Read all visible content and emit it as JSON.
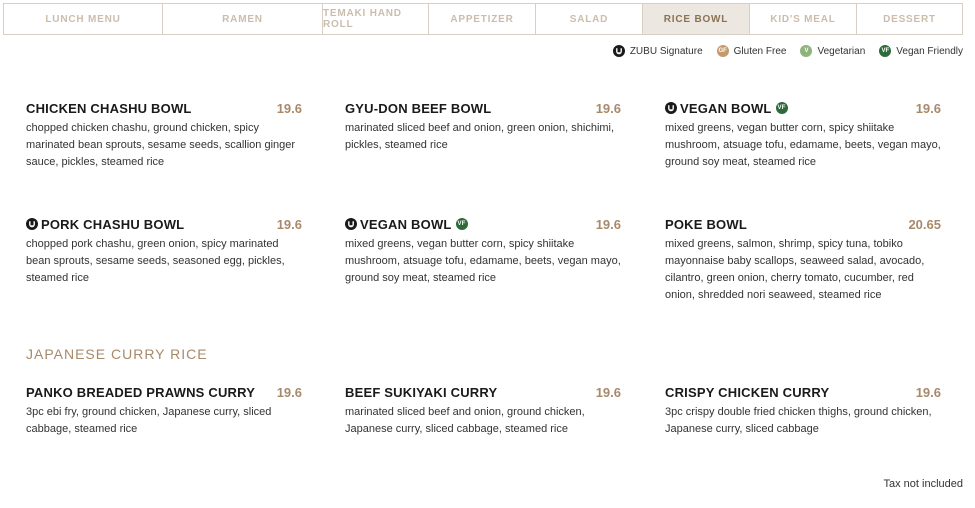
{
  "tabs": [
    {
      "label": "LUNCH MENU",
      "active": false
    },
    {
      "label": "RAMEN",
      "active": false
    },
    {
      "label": "TEMAKI HAND ROLL",
      "active": false
    },
    {
      "label": "APPETIZER",
      "active": false
    },
    {
      "label": "SALAD",
      "active": false
    },
    {
      "label": "RICE BOWL",
      "active": true
    },
    {
      "label": "KID'S MEAL",
      "active": false
    },
    {
      "label": "DESSERT",
      "active": false
    }
  ],
  "legend": {
    "zubu": {
      "abbr": "",
      "label": "ZUBU Signature",
      "color": "#1a1a1a",
      "icon": "zubu-signature-icon"
    },
    "gf": {
      "abbr": "GF",
      "label": "Gluten Free",
      "color": "#c49a6c",
      "icon": "gluten-free-icon"
    },
    "v": {
      "abbr": "V",
      "label": "Vegetarian",
      "color": "#8fb37d",
      "icon": "vegetarian-icon"
    },
    "vf": {
      "abbr": "VF",
      "label": "Vegan Friendly",
      "color": "#2f6b3a",
      "icon": "vegan-friendly-icon"
    }
  },
  "bowls": [
    {
      "name": "CHICKEN CHASHU BOWL",
      "price": "19.6",
      "desc": "chopped chicken chashu, ground chicken, spicy marinated bean sprouts, sesame seeds, scallion ginger sauce, pickles, steamed rice"
    },
    {
      "name": "GYU-DON BEEF BOWL",
      "price": "19.6",
      "desc": "marinated sliced beef and onion, green onion, shichimi, pickles, steamed rice"
    },
    {
      "name": "VEGAN BOWL",
      "price": "19.6",
      "desc": "mixed greens, vegan butter corn, spicy shiitake mushroom, atsuage tofu, edamame, beets, vegan mayo, ground soy meat, steamed rice"
    },
    {
      "name": "PORK CHASHU BOWL",
      "price": "19.6",
      "desc": "chopped pork chashu, green onion, spicy marinated bean sprouts, sesame seeds, seasoned egg, pickles, steamed rice"
    },
    {
      "name": "VEGAN BOWL",
      "price": "19.6",
      "desc": "mixed greens, vegan butter corn, spicy shiitake mushroom, atsuage tofu, edamame, beets, vegan mayo, ground soy meat, steamed rice"
    },
    {
      "name": "POKE BOWL",
      "price": "20.65",
      "desc": "mixed greens, salmon, shrimp, spicy tuna, tobiko mayonnaise baby scallops, seaweed salad, avocado, cilantro, green onion, cherry tomato, cucumber, red onion, shredded nori seaweed, steamed rice"
    }
  ],
  "curry_section": {
    "title": "JAPANESE CURRY RICE",
    "items": [
      {
        "name": "PANKO BREADED PRAWNS CURRY",
        "price": "19.6",
        "desc": "3pc ebi fry, ground chicken, Japanese curry, sliced cabbage, steamed rice"
      },
      {
        "name": "BEEF SUKIYAKI CURRY",
        "price": "19.6",
        "desc": "marinated sliced beef and onion, ground chicken, Japanese curry, sliced cabbage, steamed rice"
      },
      {
        "name": "CRISPY CHICKEN CURRY",
        "price": "19.6",
        "desc": "3pc crispy double fried chicken thighs, ground chicken, Japanese curry, sliced cabbage"
      }
    ]
  },
  "footnote": "Tax not included"
}
